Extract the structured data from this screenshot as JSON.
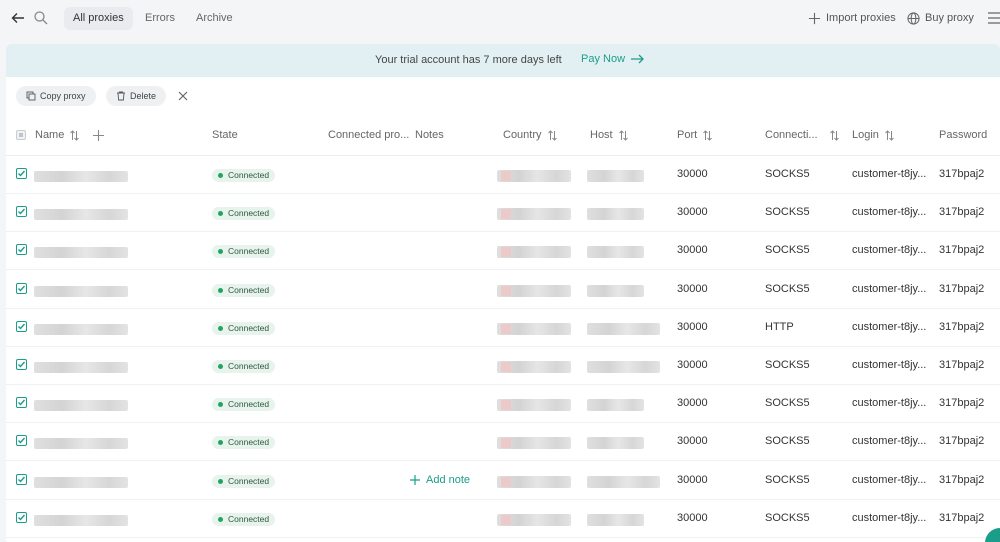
{
  "tabs": [
    {
      "label": "All proxies",
      "active": true
    },
    {
      "label": "Errors",
      "active": false
    },
    {
      "label": "Archive",
      "active": false
    }
  ],
  "top_actions": {
    "import_label": "Import proxies",
    "buy_label": "Buy proxy"
  },
  "banner": {
    "text": "Your trial account has 7 more days left",
    "link_label": "Pay Now"
  },
  "toolbar": {
    "copy_label": "Copy proxy",
    "delete_label": "Delete"
  },
  "columns": {
    "name": "Name",
    "state": "State",
    "connected": "Connected pro...",
    "notes": "Notes",
    "country": "Country",
    "host": "Host",
    "port": "Port",
    "connection": "Connecti...",
    "login": "Login",
    "password": "Password"
  },
  "add_note_label": "Add note",
  "rows": [
    {
      "state": "Connected",
      "port": "30000",
      "connection": "SOCKS5",
      "login": "customer-t8jy...",
      "password": "317bpaj2"
    },
    {
      "state": "Connected",
      "port": "30000",
      "connection": "SOCKS5",
      "login": "customer-t8jy...",
      "password": "317bpaj2"
    },
    {
      "state": "Connected",
      "port": "30000",
      "connection": "SOCKS5",
      "login": "customer-t8jy...",
      "password": "317bpaj2"
    },
    {
      "state": "Connected",
      "port": "30000",
      "connection": "SOCKS5",
      "login": "customer-t8jy...",
      "password": "317bpaj2"
    },
    {
      "state": "Connected",
      "port": "30000",
      "connection": "HTTP",
      "login": "customer-t8jy...",
      "password": "317bpaj2"
    },
    {
      "state": "Connected",
      "port": "30000",
      "connection": "SOCKS5",
      "login": "customer-t8jy...",
      "password": "317bpaj2"
    },
    {
      "state": "Connected",
      "port": "30000",
      "connection": "SOCKS5",
      "login": "customer-t8jy...",
      "password": "317bpaj2"
    },
    {
      "state": "Connected",
      "port": "30000",
      "connection": "SOCKS5",
      "login": "customer-t8jy...",
      "password": "317bpaj2"
    },
    {
      "state": "Connected",
      "port": "30000",
      "connection": "SOCKS5",
      "login": "customer-t8jy...",
      "password": "317bpaj2"
    },
    {
      "state": "Connected",
      "port": "30000",
      "connection": "SOCKS5",
      "login": "customer-t8jy...",
      "password": "317bpaj2"
    }
  ],
  "colors": {
    "accent": "#1a9e8a",
    "connected": "#23a561",
    "banner_bg": "#e3f0f3"
  },
  "icons": [
    "back-arrow-icon",
    "search-icon",
    "plus-icon",
    "globe-icon",
    "menu-icon",
    "arrow-right-icon",
    "copy-icon",
    "trash-icon",
    "close-icon",
    "sort-icon",
    "checkbox-checked-icon"
  ]
}
